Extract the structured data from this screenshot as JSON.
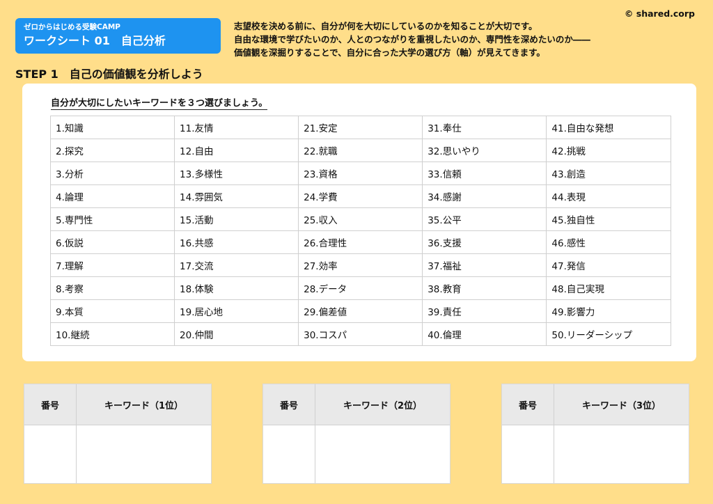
{
  "badge": {
    "subtitle": "ゼロからはじめる受験CAMP",
    "title": "ワークシート 01　自己分析"
  },
  "intro": {
    "lines": [
      "志望校を決める前に、自分が何を大切にしているのかを知ることが大切です。",
      "自由な環境で学びたいのか、人とのつながりを重視したいのか、専門性を深めたいのか――",
      "価値観を深掘りすることで、自分に合った大学の選び方（軸）が見えてきます。"
    ]
  },
  "copyright": "© shared.corp",
  "step": {
    "number": "STEP 1",
    "title": "自己の価値観を分析しよう"
  },
  "instruction": "自分が大切にしたいキーワードを３つ選びましょう。",
  "keywords": [
    "1.知識",
    "2.探究",
    "3.分析",
    "4.論理",
    "5.専門性",
    "6.仮説",
    "7.理解",
    "8.考察",
    "9.本質",
    "10.継続",
    "11.友情",
    "12.自由",
    "13.多様性",
    "14.雰囲気",
    "15.活動",
    "16.共感",
    "17.交流",
    "18.体験",
    "19.居心地",
    "20.仲間",
    "21.安定",
    "22.就職",
    "23.資格",
    "24.学費",
    "25.収入",
    "26.合理性",
    "27.効率",
    "28.データ",
    "29.偏差値",
    "30.コスパ",
    "31.奉仕",
    "32.思いやり",
    "33.信頼",
    "34.感謝",
    "35.公平",
    "36.支援",
    "37.福祉",
    "38.教育",
    "39.責任",
    "40.倫理",
    "41.自由な発想",
    "42.挑戦",
    "43.創造",
    "44.表現",
    "45.独自性",
    "46.感性",
    "47.発信",
    "48.自己実現",
    "49.影響力",
    "50.リーダーシップ"
  ],
  "answer_tables": [
    {
      "number_header": "番号",
      "keyword_header": "キーワード（1位）"
    },
    {
      "number_header": "番号",
      "keyword_header": "キーワード（2位）"
    },
    {
      "number_header": "番号",
      "keyword_header": "キーワード（3位）"
    }
  ]
}
